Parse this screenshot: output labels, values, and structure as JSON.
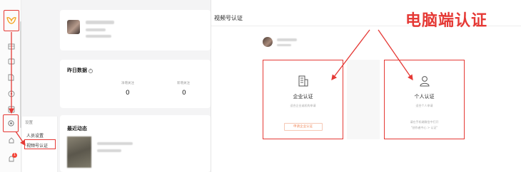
{
  "rail": {
    "icons": [
      "logo-icon",
      "home-icon",
      "video-icon",
      "document-icon",
      "compass-icon",
      "chart-icon",
      "settings-icon",
      "user-icon",
      "bell-icon"
    ],
    "notification_count": "1"
  },
  "submenu": {
    "title": "设置",
    "items": [
      {
        "label": "人员设置"
      },
      {
        "label": "视频号认证"
      }
    ]
  },
  "stats": {
    "title": "昨日数据",
    "help_icon": "?",
    "items": [
      {
        "label": "净增关注",
        "value": "0"
      },
      {
        "label": "新增关注",
        "value": "0"
      }
    ]
  },
  "recent": {
    "title": "最近动态"
  },
  "page": {
    "title": "视频号认证",
    "annotation": "电脑端认证"
  },
  "options": {
    "enterprise": {
      "title": "企业认证",
      "desc": "适合企业或机构申请",
      "button": "申请企业认证",
      "icon": "building-icon"
    },
    "personal": {
      "title": "个人认证",
      "desc": "适合个人申请",
      "desc2_line1": "请在手机端微信中打开",
      "desc2_line2": "\"创作者中心 > 认证\"",
      "icon": "person-icon"
    }
  },
  "colors": {
    "annotation_red": "#e53935",
    "button_orange": "#f08a5d"
  }
}
